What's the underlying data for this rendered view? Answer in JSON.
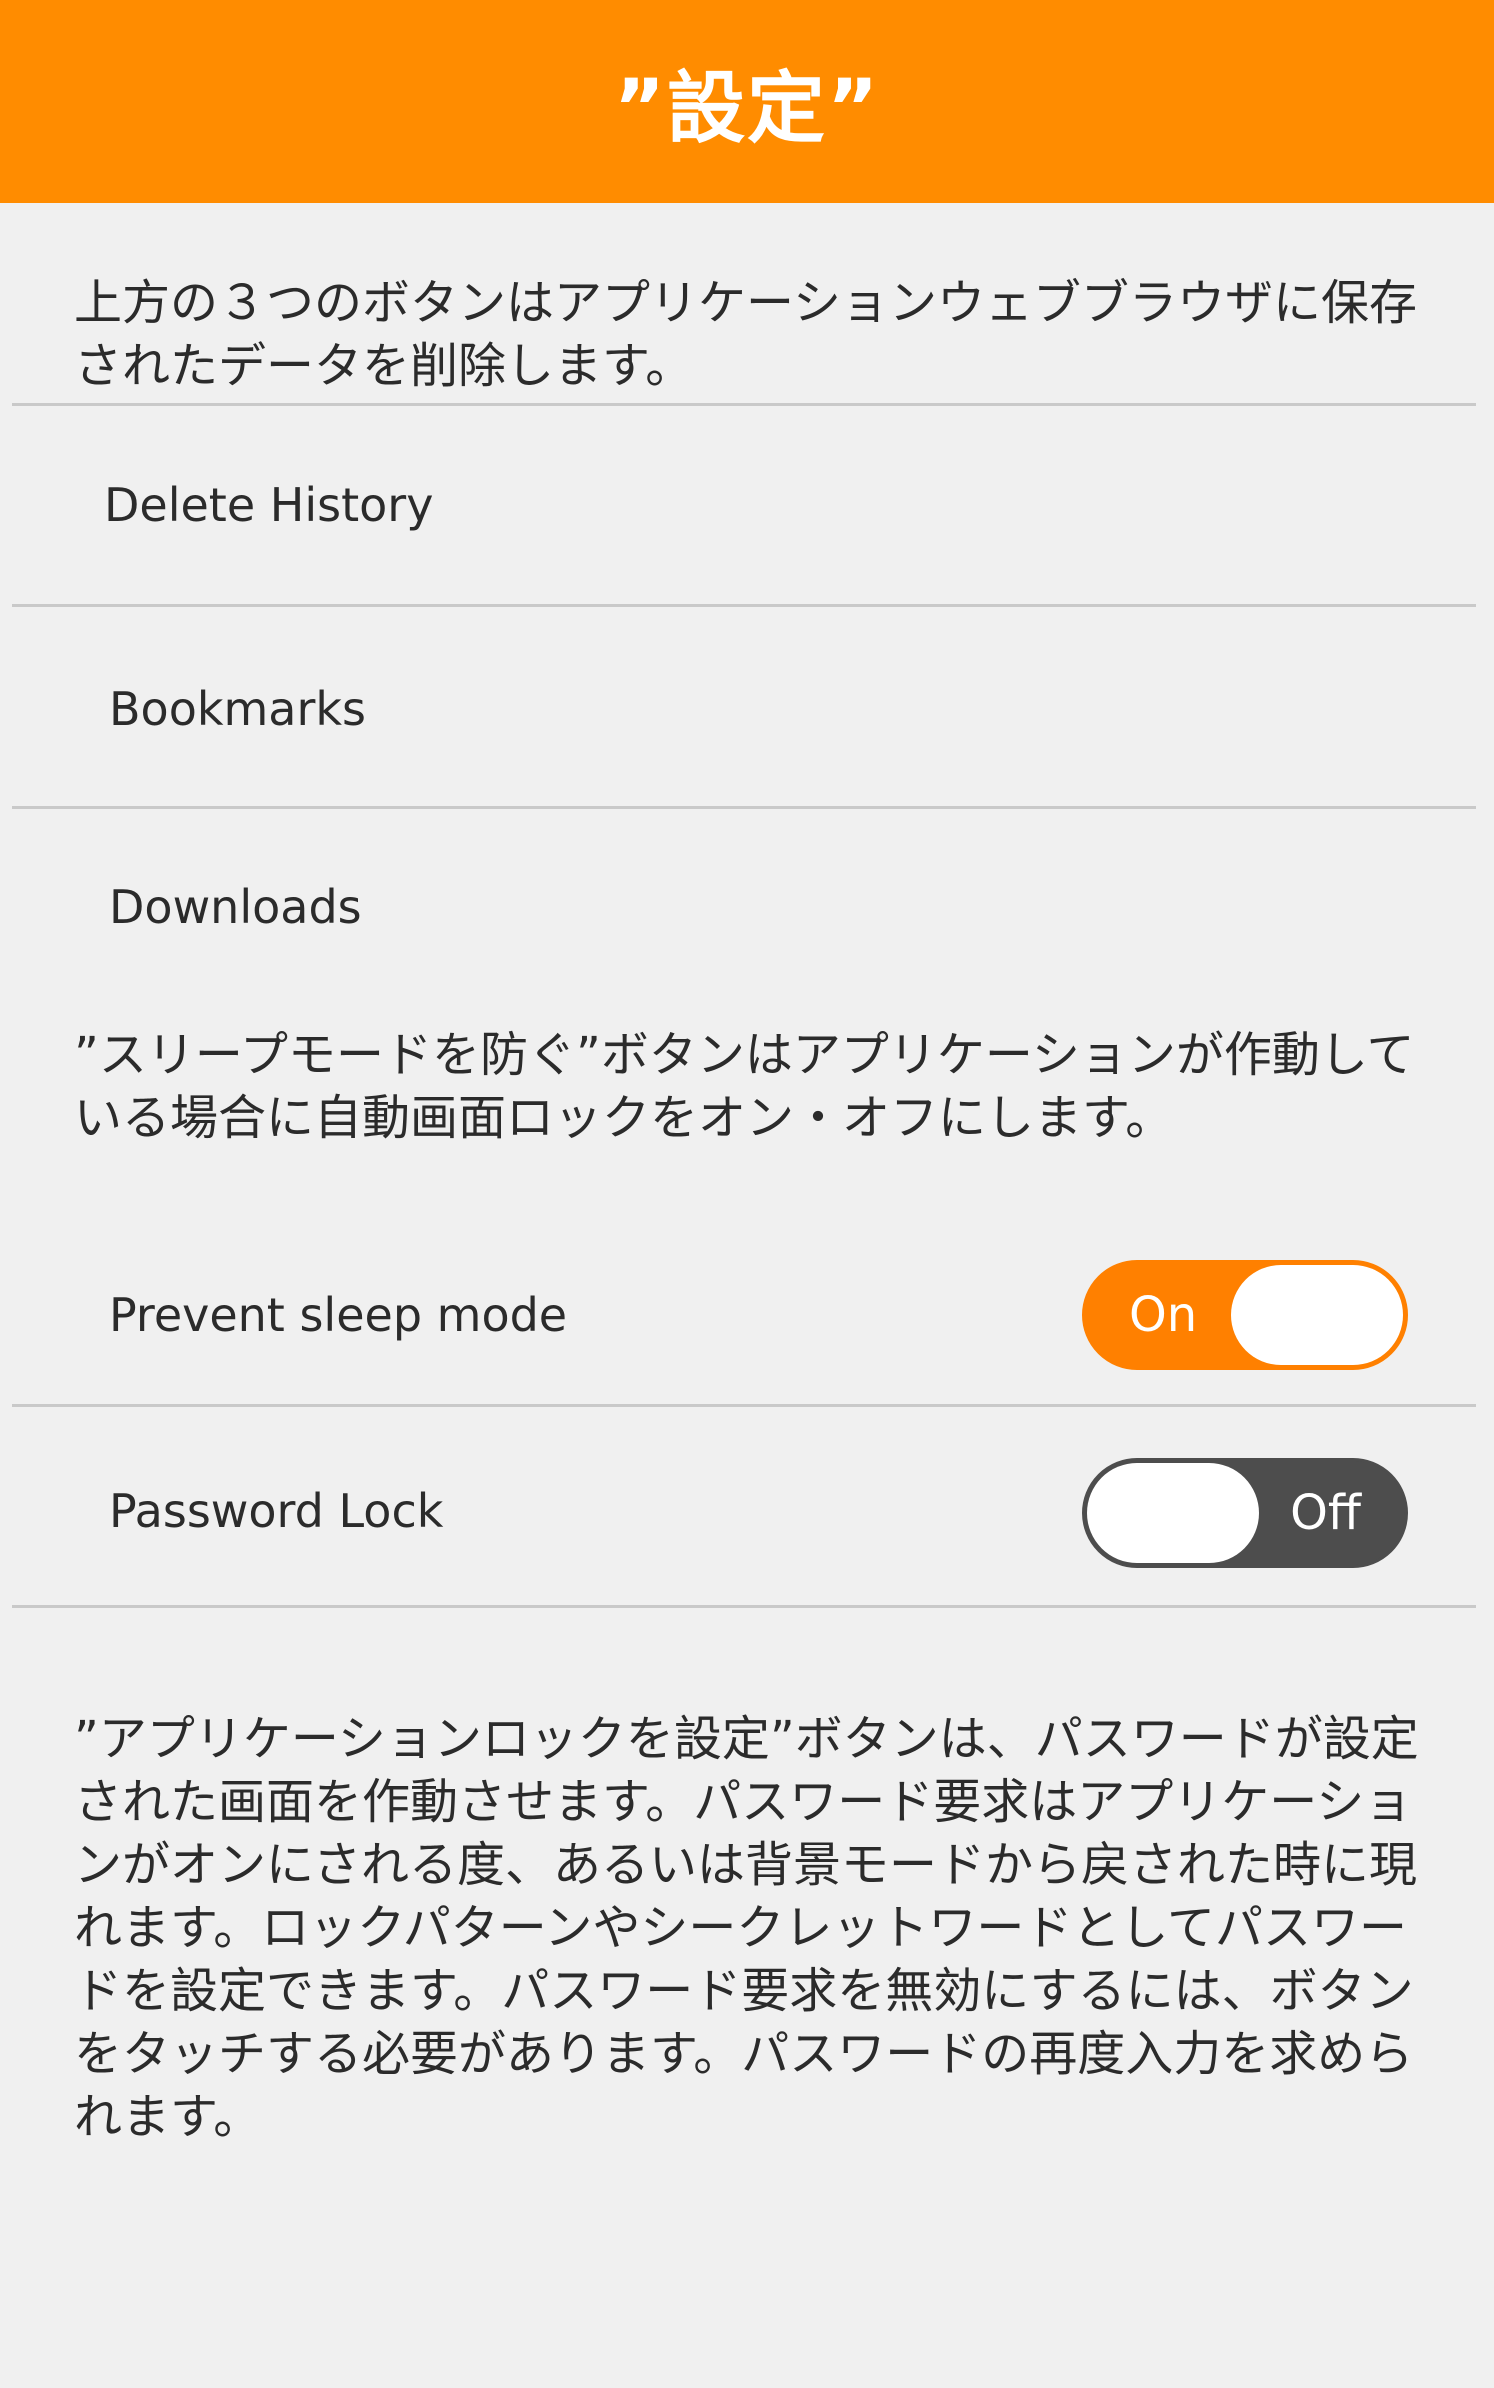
{
  "header": {
    "title": "”設定”",
    "background": "#ff8c00"
  },
  "intro_text": "上方の３つのボタンはアプリケーションウェブブラウザに保存されたデータを削除します。",
  "data_buttons": [
    {
      "label": "Delete History"
    },
    {
      "label": "Bookmarks"
    },
    {
      "label": "Downloads"
    }
  ],
  "sleep_text": "”スリープモードを防ぐ”ボタンはアプリケーションが作動している場合に自動画面ロックをオン・オフにします。",
  "toggles": [
    {
      "label": "Prevent sleep mode",
      "state_label": "On",
      "value": true,
      "color": "#ff8000"
    },
    {
      "label": "Password Lock",
      "state_label": "Off",
      "value": false,
      "color": "#4d4d4d"
    }
  ],
  "lock_text": "”アプリケーションロックを設定”ボタンは、パスワードが設定された画面を作動させます。パスワード要求はアプリケーションがオンにされる度、あるいは背景モードから戻された時に現れます。ロックパターンやシークレットワードとしてパスワードを設定できます。パスワード要求を無効にするには、ボタンをタッチする必要があります。パスワードの再度入力を求められます。"
}
